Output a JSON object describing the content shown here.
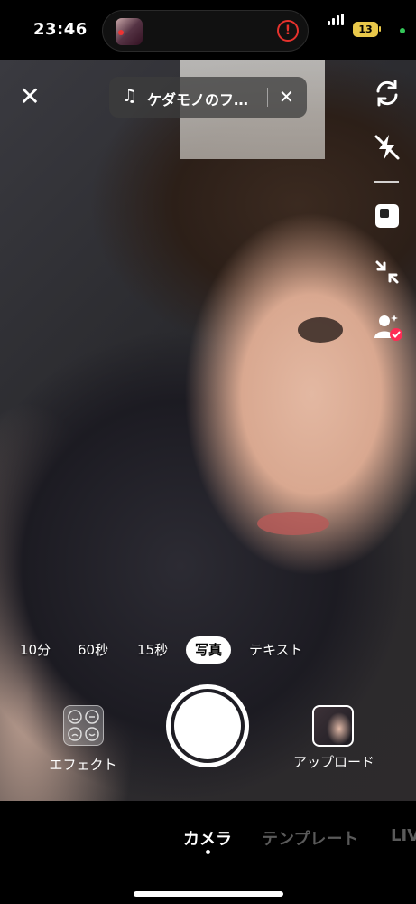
{
  "status_bar": {
    "time": "23:46",
    "battery": "13"
  },
  "top_bar": {
    "music_title": "ケダモノのフ…"
  },
  "modes": [
    "10分",
    "60秒",
    "15秒",
    "写真",
    "テキスト"
  ],
  "active_mode": "写真",
  "bottom_controls": {
    "effect_label": "エフェクト",
    "upload_label": "アップロード"
  },
  "bottom_tabs": [
    "カメラ",
    "テンプレート",
    "LIV"
  ],
  "colors": {
    "alert_red": "#e5322d",
    "battery_yellow": "#e9c84a",
    "active_tab": "#ffffff",
    "inactive_tab": "#5a5a5a"
  }
}
